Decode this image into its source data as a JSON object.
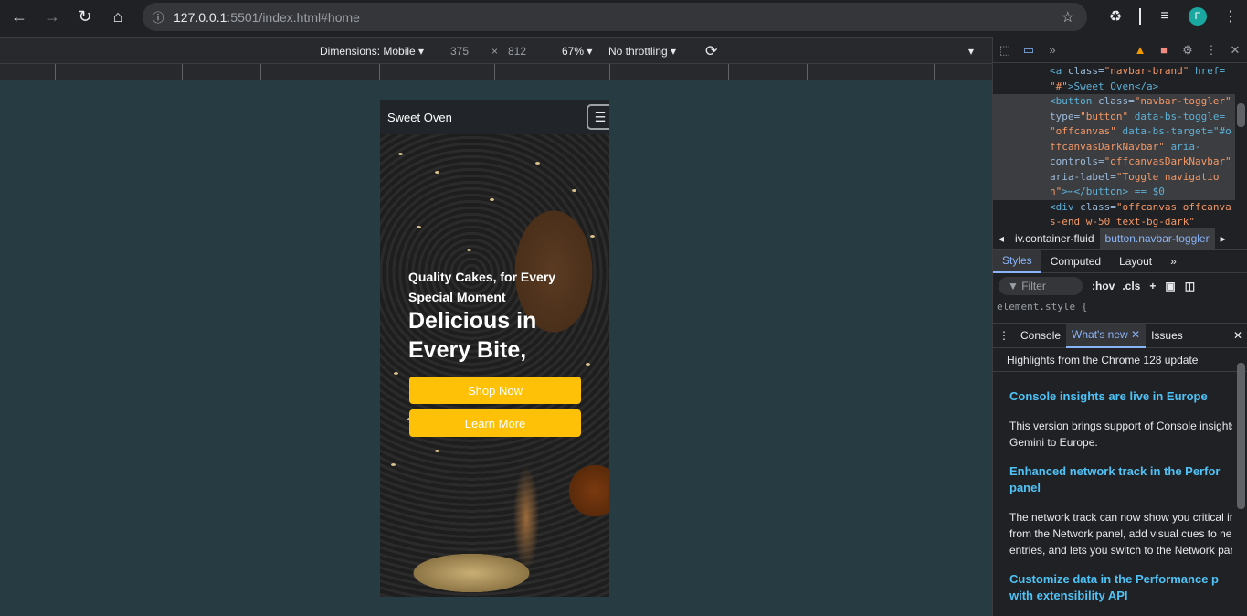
{
  "browser": {
    "url_host": "127.0.0.1",
    "url_rest": ":5501/index.html#home",
    "profile_initial": "F"
  },
  "device_toolbar": {
    "dimensions_label": "Dimensions: Mobile",
    "width": "375",
    "times": "×",
    "height": "812",
    "zoom": "67%",
    "throttling": "No throttling"
  },
  "site": {
    "brand": "Sweet Oven",
    "subtitle": "Quality Cakes, for Every Special Moment",
    "headline": "Delicious in Every Bite,",
    "shop_button": "Shop Now",
    "learn_button": "Learn More",
    "accent": "#ffc107"
  },
  "devtools": {
    "elements_lines": [
      [
        "<a",
        " class=",
        "\"navbar-brand\"",
        " href="
      ],
      [
        "",
        "",
        "\"#\"",
        ">Sweet Oven</a>"
      ],
      [
        "<button",
        " class=",
        "\"navbar-toggler\"",
        ""
      ],
      [
        "",
        "type=",
        "\"button\"",
        " data-bs-toggle="
      ],
      [
        "",
        "",
        "\"offcanvas\"",
        " data-bs-target=\"#o"
      ],
      [
        "",
        "",
        "ffcanvasDarkNavbar\"",
        " aria-"
      ],
      [
        "",
        "controls=",
        "\"offcanvasDarkNavbar\"",
        ""
      ],
      [
        "",
        "aria-label=",
        "\"Toggle navigatio",
        ""
      ],
      [
        "",
        "",
        "n\"",
        ">⋯</button> == $0"
      ],
      [
        "<div",
        " class=",
        "\"offcanvas offcanva",
        ""
      ],
      [
        "",
        "",
        "s-end w-50 text-bg-dark\"",
        ""
      ]
    ],
    "breadcrumbs": [
      "iv.container-fluid",
      "button.navbar-toggler"
    ],
    "style_tabs": [
      "Styles",
      "Computed",
      "Layout",
      "»"
    ],
    "filter_placeholder": "Filter",
    "hov": ":hov",
    "cls": ".cls",
    "element_style": "element.style {",
    "drawer_tabs": [
      "Console",
      "What's new",
      "Issues"
    ],
    "highlights": "Highlights from the Chrome 128 update",
    "news": [
      {
        "type": "h",
        "text": "Console insights are live in Europe"
      },
      {
        "type": "p",
        "text": "This version brings support of Console insights"
      },
      {
        "type": "p",
        "text": "Gemini to Europe."
      },
      {
        "type": "h",
        "text": "Enhanced network track in the Perfor"
      },
      {
        "type": "h",
        "text": "panel"
      },
      {
        "type": "p",
        "text": "The network track can now show you critical in"
      },
      {
        "type": "p",
        "text": "from the Network panel, add visual cues to ne"
      },
      {
        "type": "p",
        "text": "entries, and lets you switch to the Network par"
      },
      {
        "type": "h",
        "text": "Customize data in the Performance p"
      },
      {
        "type": "h",
        "text": "with extensibility API"
      }
    ]
  }
}
